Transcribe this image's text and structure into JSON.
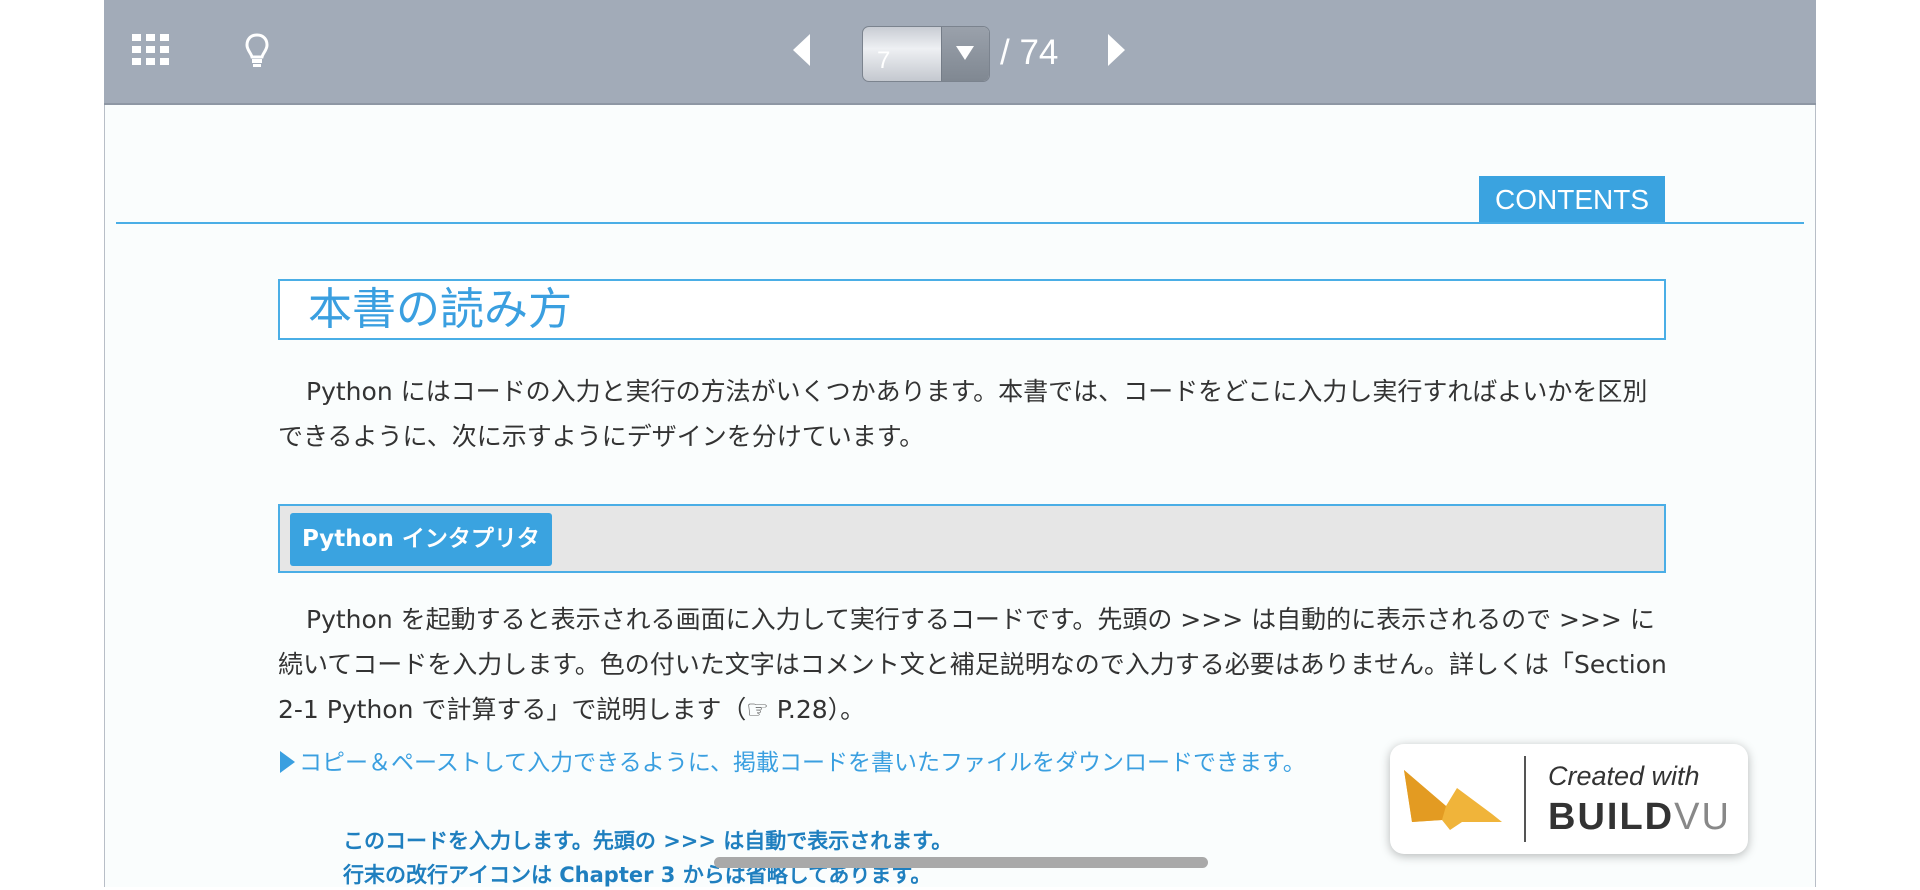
{
  "toolbar": {
    "grid_icon": "grid-icon",
    "bulb_icon": "lightbulb-icon",
    "prev_icon": "triangle-left-icon",
    "next_icon": "triangle-right-icon",
    "current_page": "7",
    "total_pages": "/ 74",
    "background_color": "#a2abb8"
  },
  "page": {
    "contents_label": "CONTENTS",
    "title": "本書の読み方",
    "intro": "Python にはコードの入力と実行の方法がいくつかあります。本書では、コードをどこに入力し実行すればよいかを区別できるように、次に示すようにデザインを分けています。",
    "section_label": "Python インタプリタ",
    "section_text": "Python を起動すると表示される画面に入力して実行するコードです。先頭の >>> は自動的に表示されるので >>> に続いてコードを入力します。色の付いた文字はコメント文と補足説明なので入力する必要はありません。詳しくは「Section 2-1 Python で計算する」で説明します（☞ P.28）。",
    "download_link": "コピー＆ペーストして入力できるように、掲載コードを書いたファイルをダウンロードできます。",
    "code_note_1": "このコードを入力します。先頭の >>> は自動で表示されます。",
    "code_note_2": "行末の改行アイコンは Chapter 3 からは省略してあります。",
    "accent_color": "#3aa3e0"
  },
  "badge": {
    "created_with": "Created with",
    "brand_bold": "BUILD",
    "brand_light": "VU",
    "logo_icon": "buildvu-logo-icon"
  }
}
